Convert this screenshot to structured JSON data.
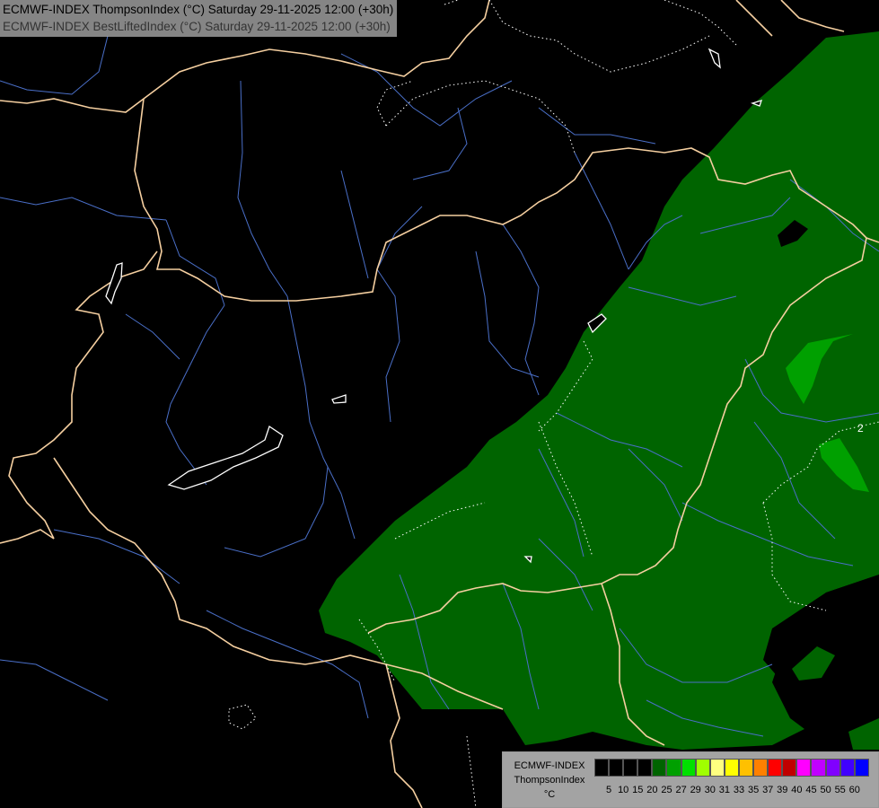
{
  "header": {
    "line1": "ECMWF-INDEX ThompsonIndex (°C) Saturday 29-11-2025 12:00 (+30h)",
    "line2": "ECMWF-INDEX BestLiftedIndex (°C) Saturday 29-11-2025 12:00 (+30h)"
  },
  "map": {
    "contour_label": "2",
    "colors": {
      "background": "#000000",
      "border": "#f5cfa0",
      "river": "#4a6fc8",
      "lake": "#ffffff",
      "shade_dark": "#006400",
      "shade_mid": "#00a000"
    }
  },
  "legend": {
    "title1": "ECMWF-INDEX",
    "title2": "ThompsonIndex",
    "unit": "°C",
    "ticks": [
      "5",
      "10",
      "15",
      "20",
      "25",
      "27",
      "29",
      "30",
      "31",
      "33",
      "35",
      "37",
      "39",
      "40",
      "45",
      "50",
      "55",
      "60"
    ],
    "colors": [
      "#000000",
      "#000000",
      "#000000",
      "#000000",
      "#006400",
      "#00a000",
      "#00e000",
      "#a0ff00",
      "#ffff80",
      "#ffff00",
      "#ffc000",
      "#ff8000",
      "#ff0000",
      "#c00000",
      "#ff00ff",
      "#c000ff",
      "#8000ff",
      "#4000ff",
      "#0000ff"
    ]
  }
}
